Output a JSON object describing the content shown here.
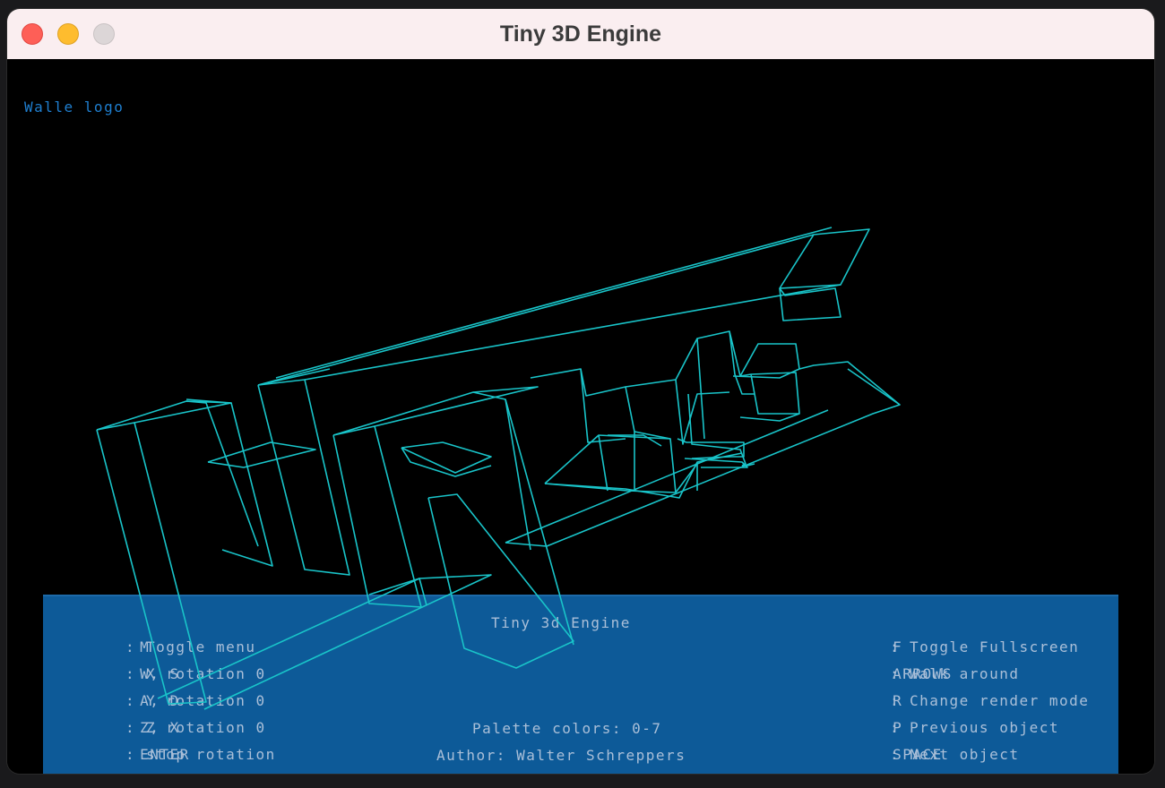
{
  "window": {
    "title": "Tiny 3D Engine"
  },
  "viewport": {
    "object_name": "Walle logo"
  },
  "menu": {
    "title": "Tiny 3d Engine",
    "palette": "Palette colors: 0-7",
    "author": "Author: Walter Schreppers",
    "left_items": [
      {
        "key": "M",
        "desc": "Toggle menu"
      },
      {
        "key": "W, S",
        "desc": "X rotation 0"
      },
      {
        "key": "A, D",
        "desc": "Y rotation 0"
      },
      {
        "key": "Z, X",
        "desc": "Z rotation 0"
      },
      {
        "key": "ENTER",
        "desc": "stop rotation"
      }
    ],
    "right_items": [
      {
        "key": "F",
        "desc": "Toggle Fullscreen"
      },
      {
        "key": "ARROWS",
        "desc": "Walk around"
      },
      {
        "key": "R",
        "desc": "Change render mode"
      },
      {
        "key": "P",
        "desc": "Previous object"
      },
      {
        "key": "SPACE",
        "desc": "Next object"
      }
    ]
  },
  "colors": {
    "wireframe": "#19c4c9",
    "menu_bg": "#0d5a98",
    "object_label": "#1f7fd0"
  }
}
